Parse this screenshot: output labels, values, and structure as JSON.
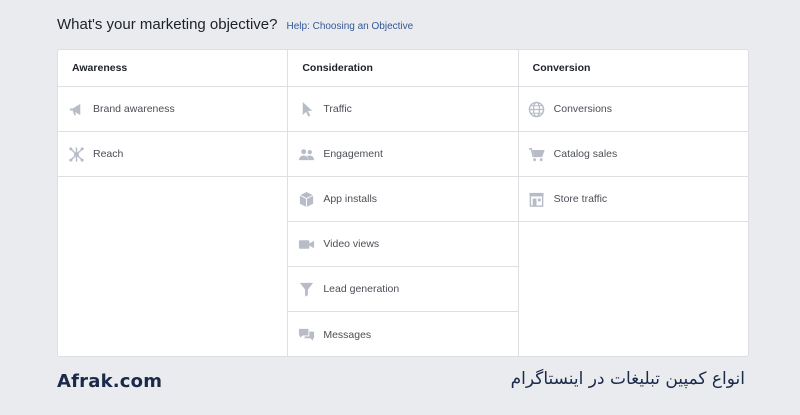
{
  "header": {
    "title": "What's your marketing objective?",
    "help_link": "Help: Choosing an Objective"
  },
  "columns": [
    {
      "title": "Awareness",
      "items": [
        {
          "label": "Brand awareness",
          "icon": "megaphone-icon"
        },
        {
          "label": "Reach",
          "icon": "reach-icon"
        }
      ]
    },
    {
      "title": "Consideration",
      "items": [
        {
          "label": "Traffic",
          "icon": "cursor-icon"
        },
        {
          "label": "Engagement",
          "icon": "people-icon"
        },
        {
          "label": "App installs",
          "icon": "box-icon"
        },
        {
          "label": "Video views",
          "icon": "video-camera-icon"
        },
        {
          "label": "Lead generation",
          "icon": "funnel-icon"
        },
        {
          "label": "Messages",
          "icon": "chat-bubbles-icon"
        }
      ]
    },
    {
      "title": "Conversion",
      "items": [
        {
          "label": "Conversions",
          "icon": "globe-icon"
        },
        {
          "label": "Catalog sales",
          "icon": "shopping-cart-icon"
        },
        {
          "label": "Store traffic",
          "icon": "store-icon"
        }
      ]
    }
  ],
  "footer": {
    "brand": "Afrak.com",
    "caption": "انواع کمپین تبلیغات در اینستاگرام"
  },
  "colors": {
    "background": "#e9ebee",
    "icon": "#b7bcc7",
    "link": "#365899",
    "footer_text": "#1b2a4a"
  }
}
